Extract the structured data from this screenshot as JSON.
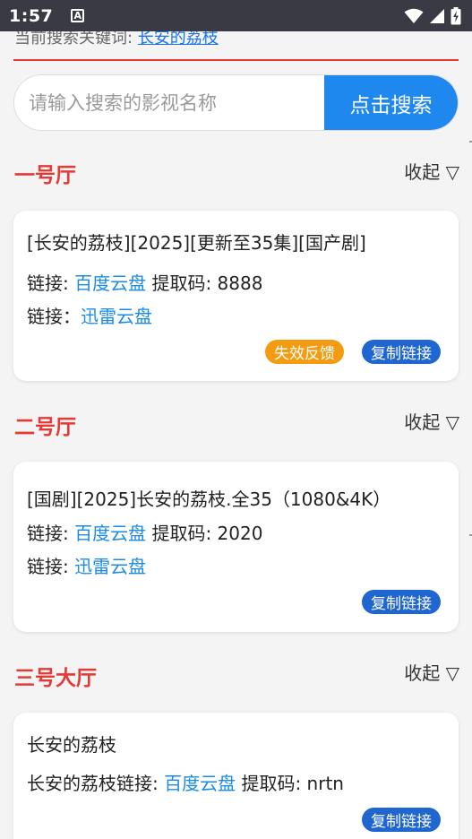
{
  "status": {
    "time": "1:57",
    "a_icon": "A"
  },
  "keyword": {
    "prefix": "当前搜索关键词: ",
    "value": "长安的荔枝"
  },
  "search": {
    "placeholder": "请输入搜索的影视名称",
    "button": "点击搜索"
  },
  "sections": [
    {
      "title": "一号厅",
      "collapse": "收起 ▽",
      "card": {
        "title": "[长安的荔枝][2025][更新至35集][国产剧]",
        "line1_prefix": "链接: ",
        "line1_link": "百度云盘",
        "line1_code": " 提取码: 8888",
        "line2_prefix": "链接：",
        "line2_link": "迅雷云盘",
        "feedback": "失效反馈",
        "copy": "复制链接"
      }
    },
    {
      "title": "二号厅",
      "collapse": "收起 ▽",
      "card": {
        "title": "[国剧][2025]长安的荔枝.全35（1080&4K）",
        "line1_prefix": "链接: ",
        "line1_link": "百度云盘",
        "line1_code": " 提取码: 2020",
        "line2_prefix": "链接: ",
        "line2_link": "迅雷云盘",
        "copy": "复制链接"
      }
    },
    {
      "title": "三号大厅",
      "collapse": "收起 ▽",
      "card": {
        "title": "长安的荔枝",
        "line1_prefix": "长安的荔枝链接: ",
        "line1_link": "百度云盘",
        "line1_code": " 提取码: nrtn",
        "copy": "复制链接"
      }
    }
  ]
}
